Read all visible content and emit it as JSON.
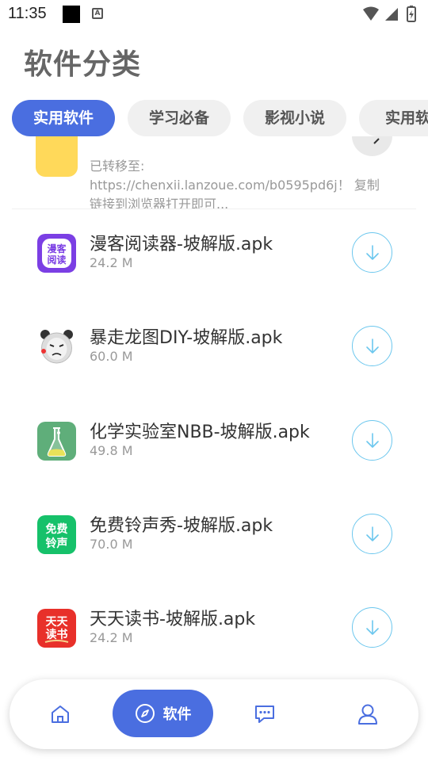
{
  "status_bar": {
    "time": "11:35",
    "a_label": "A"
  },
  "page": {
    "title": "软件分类"
  },
  "tabs": [
    {
      "label": "实用软件",
      "active": true
    },
    {
      "label": "学习必备",
      "active": false
    },
    {
      "label": "影视小说",
      "active": false
    },
    {
      "label": "实用软",
      "active": false
    }
  ],
  "partial_item": {
    "line1": "已转移至:",
    "line2": "https://chenxii.lanzoue.com/b0595pd6j！ 复制",
    "line3": "链接到浏览器打开即可..."
  },
  "apps": [
    {
      "name": "漫客阅读器-坡解版.apk",
      "size": "24.2 M",
      "icon": "manke-reader-icon",
      "icon_text": "漫客\n阅读"
    },
    {
      "name": "暴走龙图DIY-坡解版.apk",
      "size": "60.0 M",
      "icon": "panda-meme-icon",
      "icon_text": ""
    },
    {
      "name": "化学实验室NBB-坡解版.apk",
      "size": "49.8 M",
      "icon": "flask-icon",
      "icon_text": ""
    },
    {
      "name": "免费铃声秀-坡解版.apk",
      "size": "70.0 M",
      "icon": "ringtone-icon",
      "icon_text": "免费\n铃声"
    },
    {
      "name": "天天读书-坡解版.apk",
      "size": "24.2 M",
      "icon": "tiantian-book-icon",
      "icon_text": "天天\n读书"
    }
  ],
  "bottom_nav": {
    "home_icon": "home-icon",
    "software_label": "软件",
    "software_icon": "compass-icon",
    "chat_icon": "chat-bubble-icon",
    "profile_icon": "user-icon"
  },
  "colors": {
    "accent": "#4a6ee0",
    "download_ring": "#6cc7ee",
    "manke": "#7b3fe4",
    "ringtone": "#16c16a",
    "tiantian": "#e8302a",
    "flask_bg": "#5fae7a"
  }
}
